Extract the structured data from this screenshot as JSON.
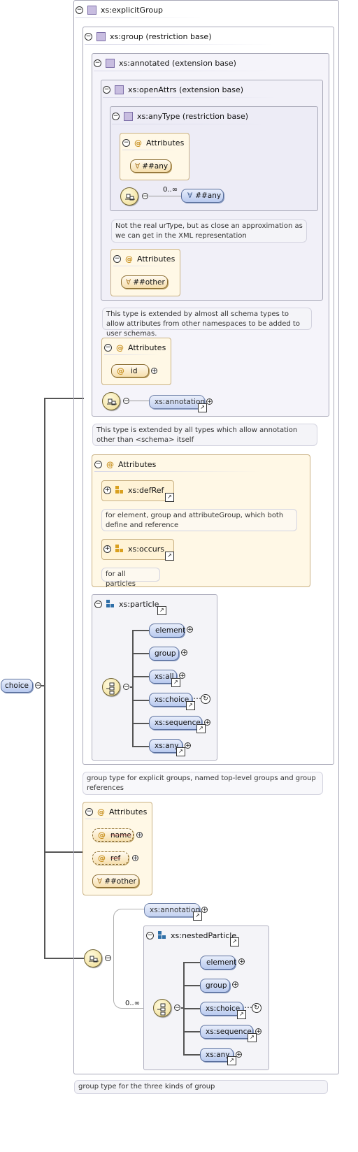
{
  "root": {
    "label": "choice"
  },
  "explicit_group": {
    "title": "xs:explicitGroup"
  },
  "group_restriction": {
    "title": "xs:group (restriction base)"
  },
  "annotated_extension": {
    "title": "xs:annotated (extension base)"
  },
  "openattrs_extension": {
    "title": "xs:openAttrs (extension base)"
  },
  "anytype_restriction": {
    "title": "xs:anyType (restriction base)",
    "attributes_title": "Attributes",
    "any_attribute": "##any",
    "occurs": "0..∞",
    "any_element": "##any",
    "note": "Not the real urType, but as close an approximation as we can get in the XML representation"
  },
  "openattrs_attributes": {
    "title": "Attributes",
    "other": "##other"
  },
  "openattrs_note": "This type is extended by almost all schema types to allow attributes from other namespaces to be added to user schemas.",
  "annotated_attributes": {
    "title": "Attributes",
    "id": "id"
  },
  "annotated_annotation": "xs:annotation",
  "annotated_note": "This type is extended by all types which allow annotation other than <schema> itself",
  "group_attributes": {
    "title": "Attributes",
    "defref": "xs:defRef",
    "defref_note": "for element, group and attributeGroup, which both define and reference",
    "occurs": "xs:occurs",
    "occurs_note": "for all particles"
  },
  "particle": {
    "title": "xs:particle",
    "items": [
      "element",
      "group",
      "xs:all",
      "xs:choice",
      "xs:sequence",
      "xs:any"
    ]
  },
  "explicit_note": "group type for explicit groups, named top-level groups and group references",
  "explicit_attributes": {
    "title": "Attributes",
    "name": "name",
    "ref": "ref",
    "other": "##other"
  },
  "sequence": {
    "annotation": "xs:annotation",
    "occurs": "0..∞",
    "nested_title": "xs:nestedParticle",
    "items": [
      "element",
      "group",
      "xs:choice",
      "xs:sequence",
      "xs:any"
    ]
  },
  "bottom_note": "group type for the three kinds of group",
  "icons": {
    "expand": "circle-minus-icon",
    "collapse": "circle-plus-icon",
    "type": "complex-type-cube-icon",
    "attribute": "at-sign-icon",
    "any": "wildcard-icon",
    "sequence": "sequence-compositor-icon",
    "choice": "choice-compositor-icon",
    "link": "reference-arrow-icon"
  },
  "colors": {
    "element_pill": "#b9caef",
    "attribute_pill": "#f6dfad",
    "attribute_box": "#fff8e6",
    "type_cube": "#c8bde0"
  }
}
